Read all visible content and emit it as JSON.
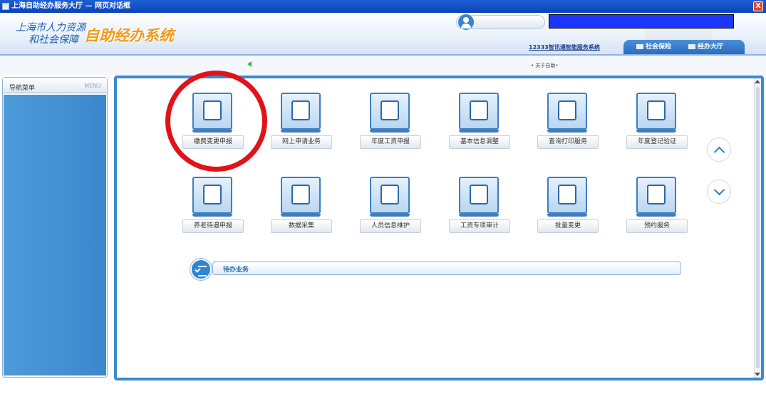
{
  "window": {
    "title": "上海自助经办服务大厅 — 网页对话框",
    "close_label": "X"
  },
  "header": {
    "org_line1": "上海市人力资源",
    "org_line2": "和社会保障",
    "system_title": "自助经办系统",
    "service_link": "12333智讯通智能服务系统",
    "tabs": [
      {
        "label": "社会保险",
        "icon": "monitor-icon"
      },
      {
        "label": "经办大厅",
        "icon": "building-icon"
      }
    ]
  },
  "subbar": {
    "about": "• 关于自助•"
  },
  "sidebar": {
    "title": "导航菜单",
    "menu_tag": "MENU"
  },
  "tiles": [
    {
      "label": "缴费变更申报",
      "icon": "person-coins-icon"
    },
    {
      "label": "网上申请业务",
      "icon": "heart-hand-icon"
    },
    {
      "label": "年度工资申报",
      "icon": "monitor-icon"
    },
    {
      "label": "基本信息调整",
      "icon": "yen-document-icon"
    },
    {
      "label": "查询打印服务",
      "icon": "home-icon"
    },
    {
      "label": "年度登记验证",
      "icon": "document-search-icon"
    },
    {
      "label": "养老待遇申报",
      "icon": "printer-icon"
    },
    {
      "label": "数据采集",
      "icon": "chat-bubble-icon"
    },
    {
      "label": "人员信息维护",
      "icon": "edit-document-icon"
    },
    {
      "label": "工资专项审计",
      "icon": "printer-icon"
    },
    {
      "label": "批量变更",
      "icon": "presentation-icon"
    },
    {
      "label": "预约服务",
      "icon": "monitor-icon"
    }
  ],
  "pending": {
    "label": "待办业务"
  },
  "colors": {
    "accent": "#3c8ad1",
    "highlight": "#e2121b",
    "title_orange": "#f19a1a"
  }
}
